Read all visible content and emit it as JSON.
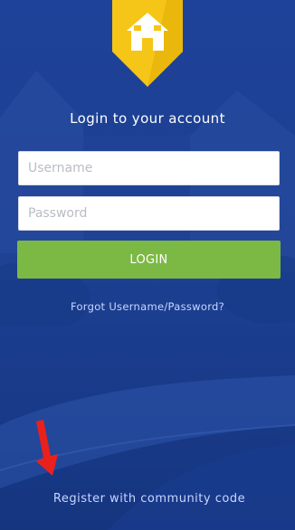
{
  "app": {
    "logo_icon": "house-icon",
    "colors": {
      "background": "#1b3f93",
      "logo_badge": "#f5c518",
      "login_button": "#7cb944",
      "link_text": "#c9d6ff",
      "annotation_arrow": "#e8211d"
    }
  },
  "login": {
    "title": "Login to your account",
    "username_placeholder": "Username",
    "password_placeholder": "Password",
    "login_button_label": "LOGIN",
    "forgot_link_label": "Forgot Username/Password?",
    "register_link_label": "Register with community code"
  },
  "annotation": {
    "icon": "red-arrow-icon"
  }
}
